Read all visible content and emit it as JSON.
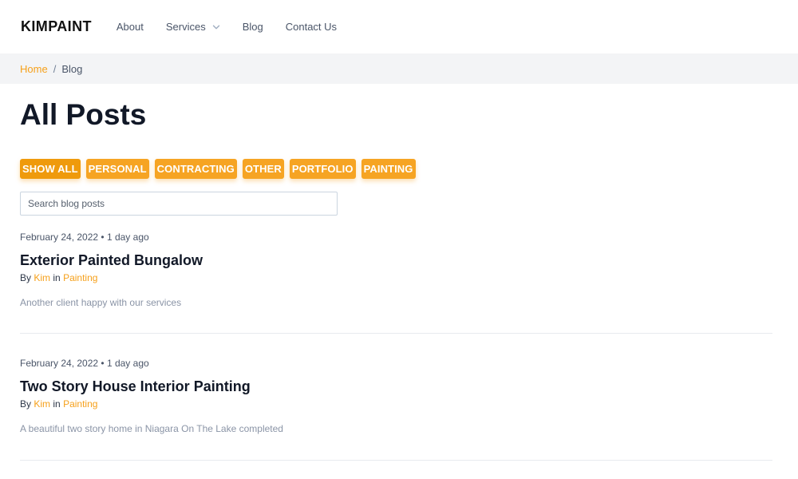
{
  "nav": {
    "brand": "KIMPAINT",
    "links": [
      {
        "label": "About"
      },
      {
        "label": "Services"
      },
      {
        "label": "Blog"
      },
      {
        "label": "Contact Us"
      }
    ]
  },
  "breadcrumb": {
    "home": "Home",
    "separator": "/",
    "current": "Blog"
  },
  "main": {
    "title": "All Posts",
    "filters": [
      "SHOW ALL",
      "PERSONAL",
      "CONTRACTING",
      "OTHER",
      "PORTFOLIO",
      "PAINTING"
    ],
    "active_filter": "SHOW ALL",
    "search_placeholder": "Search blog posts",
    "search_value": ""
  },
  "posts": [
    {
      "date": "February 24, 2022",
      "bullet": "•",
      "ago": "1 day ago",
      "title": "Exterior Painted Bungalow",
      "by": "By",
      "author": "Kim",
      "in": "in",
      "category": "Painting",
      "excerpt": "Another client happy with our services"
    },
    {
      "date": "February 24, 2022",
      "bullet": "•",
      "ago": "1 day ago",
      "title": "Two Story House Interior Painting",
      "by": "By",
      "author": "Kim",
      "in": "in",
      "category": "Painting",
      "excerpt": "A beautiful two story home in Niagara On The Lake completed"
    }
  ],
  "colors": {
    "accent": "#f6a423",
    "accent_active": "#ef9a0c",
    "breadcrumb_bg": "#f3f4f6"
  },
  "icons": {
    "services_dropdown": "chevron-down-icon"
  }
}
